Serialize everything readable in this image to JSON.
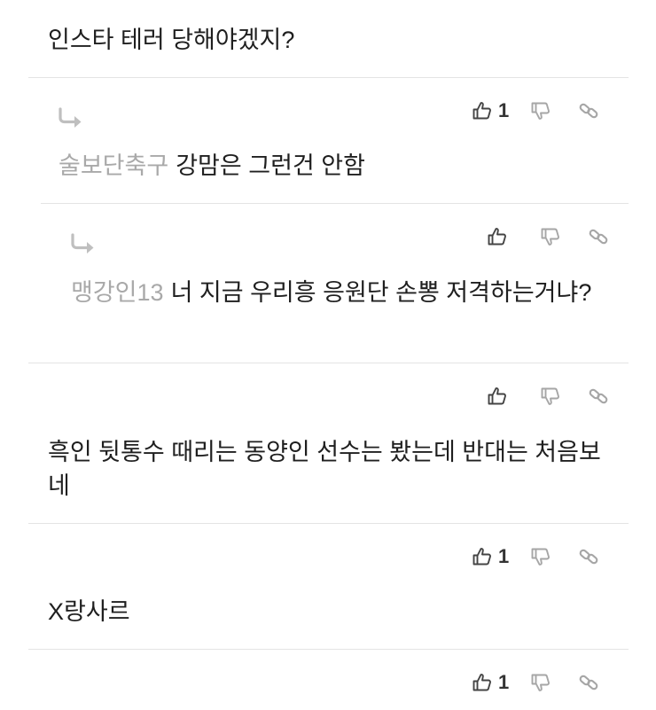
{
  "colors": {
    "text": "#1f1f1f",
    "author": "#a9a9a9",
    "separator": "#e4e4e4",
    "icon_dark": "#444444",
    "icon_light": "#a6a6a6"
  },
  "comments": [
    {
      "text": "인스타 테러 당해야겠지?",
      "like_count": "",
      "is_reply": false
    },
    {
      "author": "술보단축구",
      "text": "강맘은 그런건 안함",
      "like_count": "1",
      "is_reply": true
    },
    {
      "author": "맹강인13",
      "text": "너 지금 우리흥 응원단 손뽕 저격하는거냐?",
      "like_count": "",
      "is_reply": true
    },
    {
      "text": "흑인 뒷통수 때리는 동양인 선수는 봤는데 반대는 처음보네",
      "like_count": "",
      "is_reply": false
    },
    {
      "text": "X랑사르",
      "like_count": "1",
      "is_reply": false
    },
    {
      "text": "",
      "like_count": "1",
      "is_reply": false
    }
  ],
  "icons": {
    "like": "thumbs-up-icon",
    "dislike": "thumbs-down-icon",
    "link": "link-icon",
    "reply": "reply-arrow-icon"
  }
}
